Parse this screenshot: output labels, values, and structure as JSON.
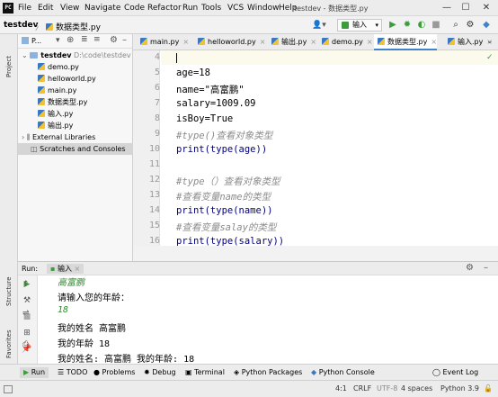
{
  "window": {
    "app_icon": "PC",
    "title": "testdev - 数据类型.py",
    "menu": [
      "File",
      "Edit",
      "View",
      "Navigate",
      "Code",
      "Refactor",
      "Run",
      "Tools",
      "VCS",
      "Window",
      "Help"
    ],
    "minimize": "—",
    "maximize": "☐",
    "close": "✕"
  },
  "navbar": {
    "project": "testdev",
    "separator": "〉",
    "file": "数据类型.py",
    "run_config": "输入",
    "user_icon": "👤▾"
  },
  "strip": {
    "project_label": "Project",
    "structure_label": "Structure",
    "favorites_label": "Favorites"
  },
  "project": {
    "header": "P...",
    "root": {
      "name": "testdev",
      "path": "D:\\code\\testdev"
    },
    "files": [
      "demo.py",
      "helloworld.py",
      "main.py",
      "数据类型.py",
      "输入.py",
      "输出.py"
    ],
    "external": "External Libraries",
    "scratches": "Scratches and Consoles"
  },
  "tabs": [
    {
      "label": "main.py",
      "active": false
    },
    {
      "label": "helloworld.py",
      "active": false
    },
    {
      "label": "输出.py",
      "active": false
    },
    {
      "label": "demo.py",
      "active": false
    },
    {
      "label": "数据类型.py",
      "active": true
    },
    {
      "label": "输入.py",
      "active": false
    }
  ],
  "editor": {
    "lines": [
      {
        "n": "4",
        "code": ""
      },
      {
        "n": "5",
        "code": "age=18"
      },
      {
        "n": "6",
        "code": "name=\"高富鹏\""
      },
      {
        "n": "7",
        "code": "salary=1009.09"
      },
      {
        "n": "8",
        "code": "isBoy=True"
      },
      {
        "n": "9",
        "code": "#type()查看对象类型"
      },
      {
        "n": "10",
        "code": "print(type(age))"
      },
      {
        "n": "11",
        "code": ""
      },
      {
        "n": "12",
        "code": "#type（）查看对象类型"
      },
      {
        "n": "13",
        "code": "#查看变量name的类型"
      },
      {
        "n": "14",
        "code": "print(type(name))"
      },
      {
        "n": "15",
        "code": "#查看变量salay的类型"
      },
      {
        "n": "16",
        "code": "print(type(salary))"
      }
    ]
  },
  "run": {
    "label": "Run:",
    "config": "输入",
    "output": [
      {
        "text": "高富鹏",
        "style": "green"
      },
      {
        "text": "请输入您的年龄：",
        "style": "normal"
      },
      {
        "text": "18",
        "style": "green"
      },
      {
        "text": "我的姓名 高富鹏",
        "style": "normal"
      },
      {
        "text": "我的年龄 18",
        "style": "normal"
      },
      {
        "text": "我的姓名: 高富鹏 我的年龄: 18",
        "style": "normal"
      }
    ]
  },
  "bottom_tabs": [
    "Run",
    "TODO",
    "Problems",
    "Debug",
    "Terminal",
    "Python Packages",
    "Python Console",
    "Event Log"
  ],
  "status": {
    "position": "4:1",
    "line_sep": "CRLF",
    "encoding": "UTF-8",
    "indent": "4 spaces",
    "interpreter": "Python 3.9"
  },
  "colors": {
    "accent": "#4083c9",
    "run_green": "#3d9c3d",
    "string": "#067d17",
    "number": "#1750eb",
    "comment": "#8c8c8c"
  }
}
